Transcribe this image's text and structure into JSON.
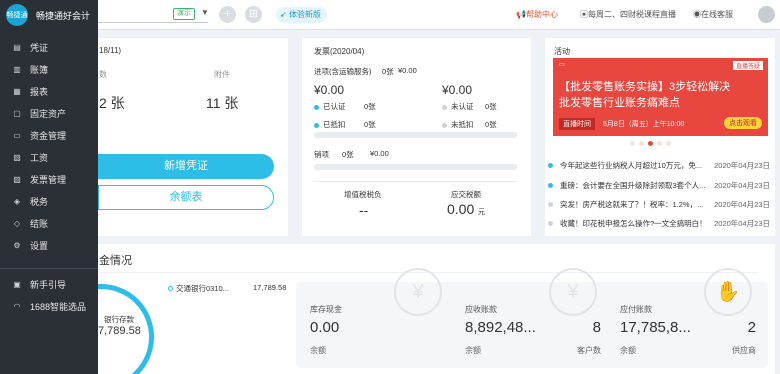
{
  "brand": {
    "logo_text": "畅捷通",
    "name": "畅捷通好会计"
  },
  "topbar": {
    "demo_badge": "演示",
    "trial_label": "体验新版",
    "help": "帮助中心",
    "live": "每周二、四财税课程直播",
    "service": "在线客服"
  },
  "sidebar": {
    "items": [
      {
        "label": "凭证",
        "icon": "voucher-icon"
      },
      {
        "label": "账簿",
        "icon": "ledger-icon"
      },
      {
        "label": "报表",
        "icon": "report-icon"
      },
      {
        "label": "固定资产",
        "icon": "asset-icon"
      },
      {
        "label": "资金管理",
        "icon": "fund-icon"
      },
      {
        "label": "工资",
        "icon": "salary-icon"
      },
      {
        "label": "发票管理",
        "icon": "invoice-icon"
      },
      {
        "label": "税务",
        "icon": "tax-icon"
      },
      {
        "label": "结账",
        "icon": "close-icon"
      },
      {
        "label": "设置",
        "icon": "gear-icon"
      }
    ],
    "bottom": [
      {
        "label": "新手引导",
        "icon": "guide-icon"
      },
      {
        "label": "1688智能选品",
        "icon": "shop-icon"
      }
    ]
  },
  "voucher_card": {
    "title_frag": "18/11)",
    "col1_label": "数",
    "col1_value": "2 张",
    "col2_label": "附件",
    "col2_value": "11 张",
    "new_button": "新增凭证",
    "balance_button": "余额表"
  },
  "invoice_card": {
    "title": "发票(2020/04)",
    "input_label": "进项(含运输服务)",
    "input_count": "0张",
    "input_amount": "¥0.00",
    "left_amount": "¥0.00",
    "certified": "已认证",
    "certified_cnt": "0张",
    "deducted": "已抵扣",
    "deducted_cnt": "0张",
    "right_amount": "¥0.00",
    "uncertified": "未认证",
    "uncertified_cnt": "0张",
    "undeducted": "未抵扣",
    "undeducted_cnt": "0张",
    "output_label": "销项",
    "output_count": "0张",
    "output_amount": "¥0.00",
    "vat_label": "增值税税负",
    "vat_value": "--",
    "tax_label": "应交税额",
    "tax_value": "0.00",
    "tax_unit": "元"
  },
  "activity_card": {
    "title": "活动",
    "banner_tag": "直播答疑",
    "banner_line1": "【批发零售账务实操】3步轻松解决",
    "banner_line2": "批发零售行业账务痛难点",
    "banner_time_label": "直播时间",
    "banner_time": "5月8日（周五）上午10:00",
    "banner_cta": "点击观看",
    "news": [
      {
        "text": "今年起这些行业纳税人月超过10万元，免...",
        "date": "2020年04月23日",
        "color": "#2dbde6"
      },
      {
        "text": "重磅：会计要在全国升级除封领取3套个人...",
        "date": "2020年04月23日",
        "color": "#2dbde6"
      },
      {
        "text": "突发！房产税这就来了？！税率：1.2%，...",
        "date": "2020年04月23日",
        "color": "#cfd3d7"
      },
      {
        "text": "收藏！印花税申报怎么操作?一文全搞明白！",
        "date": "2020年04月23日",
        "color": "#cfd3d7"
      }
    ]
  },
  "funds": {
    "title_frag": "金情况",
    "ring_label": "银行存款",
    "ring_value": "7,789.58",
    "bank_name": "交通银行0310...",
    "bank_amount": "17,789.58",
    "cards": [
      {
        "label": "库存现金",
        "value": "0.00",
        "sub": "余额",
        "count": "",
        "count_label": ""
      },
      {
        "label": "应收账款",
        "value": "8,892,48...",
        "sub": "余额",
        "count": "8",
        "count_label": "客户数"
      },
      {
        "label": "应付账款",
        "value": "17,785,8...",
        "sub": "余额",
        "count": "2",
        "count_label": "供应商"
      }
    ]
  },
  "colors": {
    "accent": "#2dbde6",
    "sidebar": "#2b3036",
    "banner": "#e8473f"
  }
}
